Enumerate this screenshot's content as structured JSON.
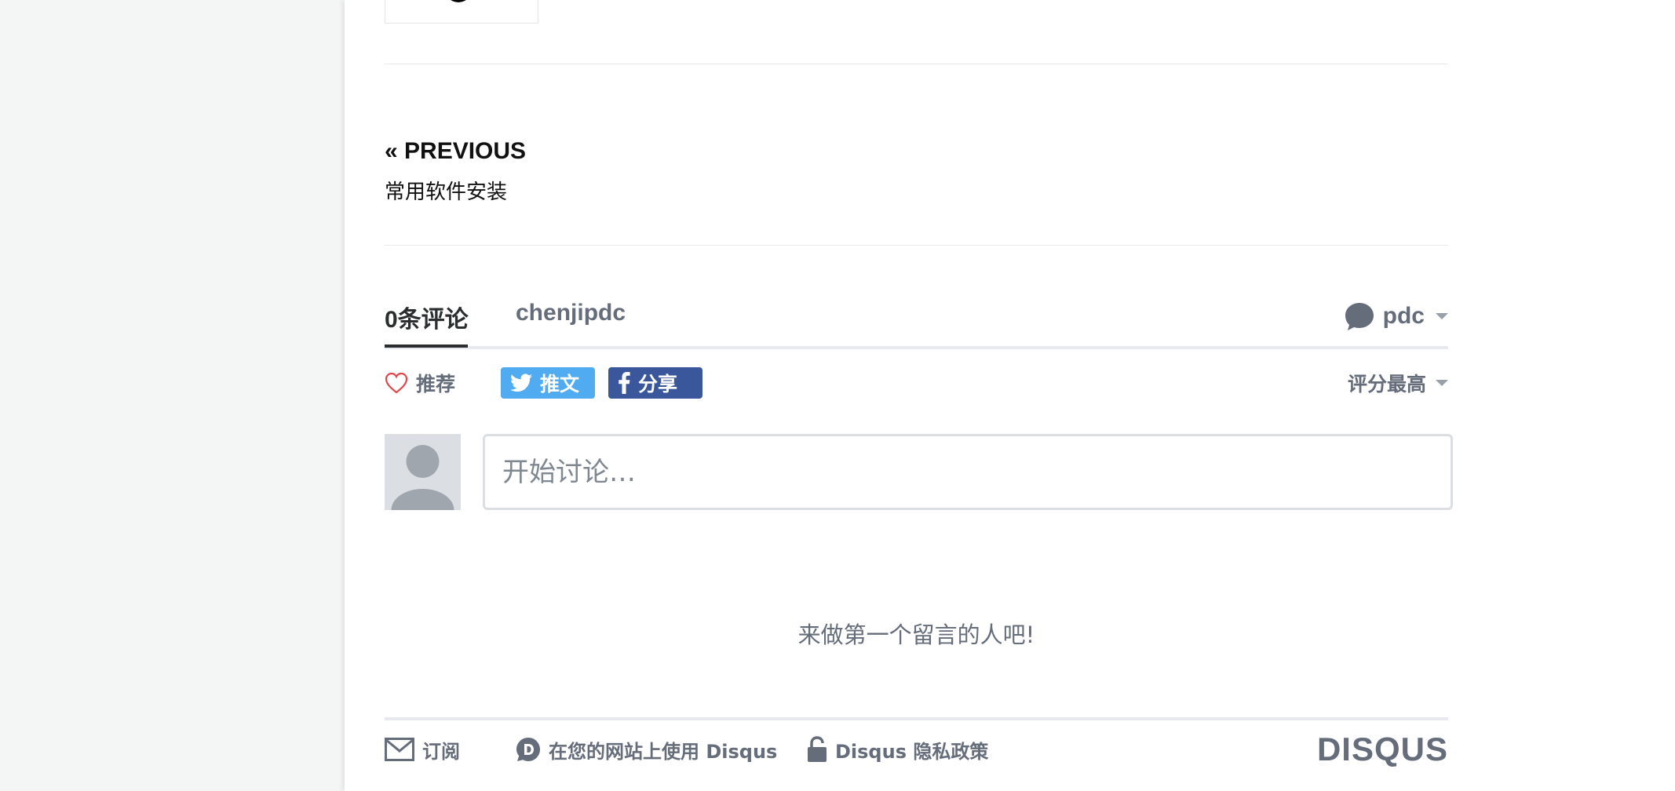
{
  "nav": {
    "previous_label": "« PREVIOUS",
    "previous_title": "常用软件安装"
  },
  "comments": {
    "count_tab": "0条评论",
    "forum_tab": "chenjipdc",
    "user_name": "pdc",
    "recommend_label": "推荐",
    "tweet_label": "推文",
    "share_label": "分享",
    "sort_label": "评分最高",
    "composer_placeholder": "开始讨论…",
    "empty_message": "来做第一个留言的人吧!"
  },
  "footer": {
    "subscribe_label": "订阅",
    "add_disqus_label": "在您的网站上使用 Disqus",
    "privacy_label": "Disqus 隐私政策",
    "logo_text": "DISQUS"
  },
  "icons": {
    "heart": "heart-icon",
    "twitter": "twitter-icon",
    "facebook": "facebook-icon",
    "chat": "chat-bubble-icon",
    "mail": "mail-icon",
    "disqus_d": "disqus-d-icon",
    "lock": "lock-icon"
  },
  "colors": {
    "twitter": "#50abf1",
    "facebook": "#39579a",
    "text_muted": "#656c7a",
    "text_dark": "#2a2e2e",
    "heart": "#e0474c"
  }
}
